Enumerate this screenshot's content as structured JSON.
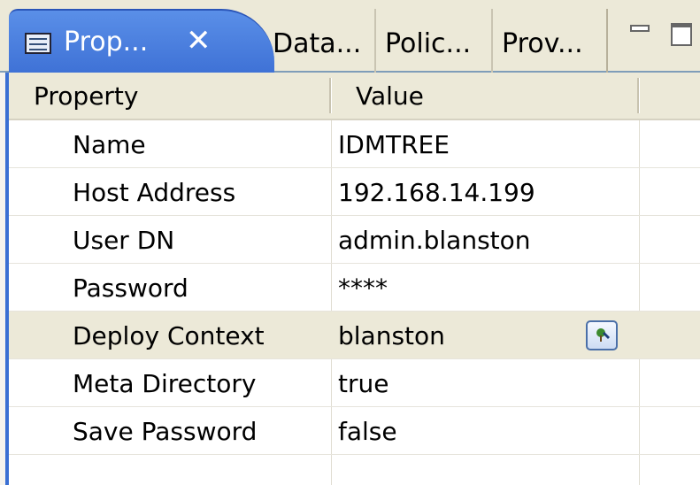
{
  "tabs": {
    "active": {
      "label": "Prop...",
      "close_glyph": "✕"
    },
    "others": [
      {
        "label": "Data..."
      },
      {
        "label": "Polic..."
      },
      {
        "label": "Prov..."
      }
    ]
  },
  "table": {
    "columns": {
      "property": "Property",
      "value": "Value"
    },
    "rows": [
      {
        "property": "Name",
        "value": "IDMTREE"
      },
      {
        "property": "Host Address",
        "value": "192.168.14.199"
      },
      {
        "property": "User DN",
        "value": "admin.blanston"
      },
      {
        "property": "Password",
        "value": "****"
      },
      {
        "property": "Deploy Context",
        "value": "blanston"
      },
      {
        "property": "Meta Directory",
        "value": "true"
      },
      {
        "property": "Save Password",
        "value": "false"
      }
    ],
    "selected_row": "Deploy Context"
  },
  "icons": {
    "tab_icon": "properties-list-icon",
    "browse_icon": "tree-browse-icon",
    "minimize": "minimize-icon",
    "maximize": "maximize-icon"
  },
  "colors": {
    "accent": "#3f72d6",
    "chrome": "#ece9d8"
  }
}
